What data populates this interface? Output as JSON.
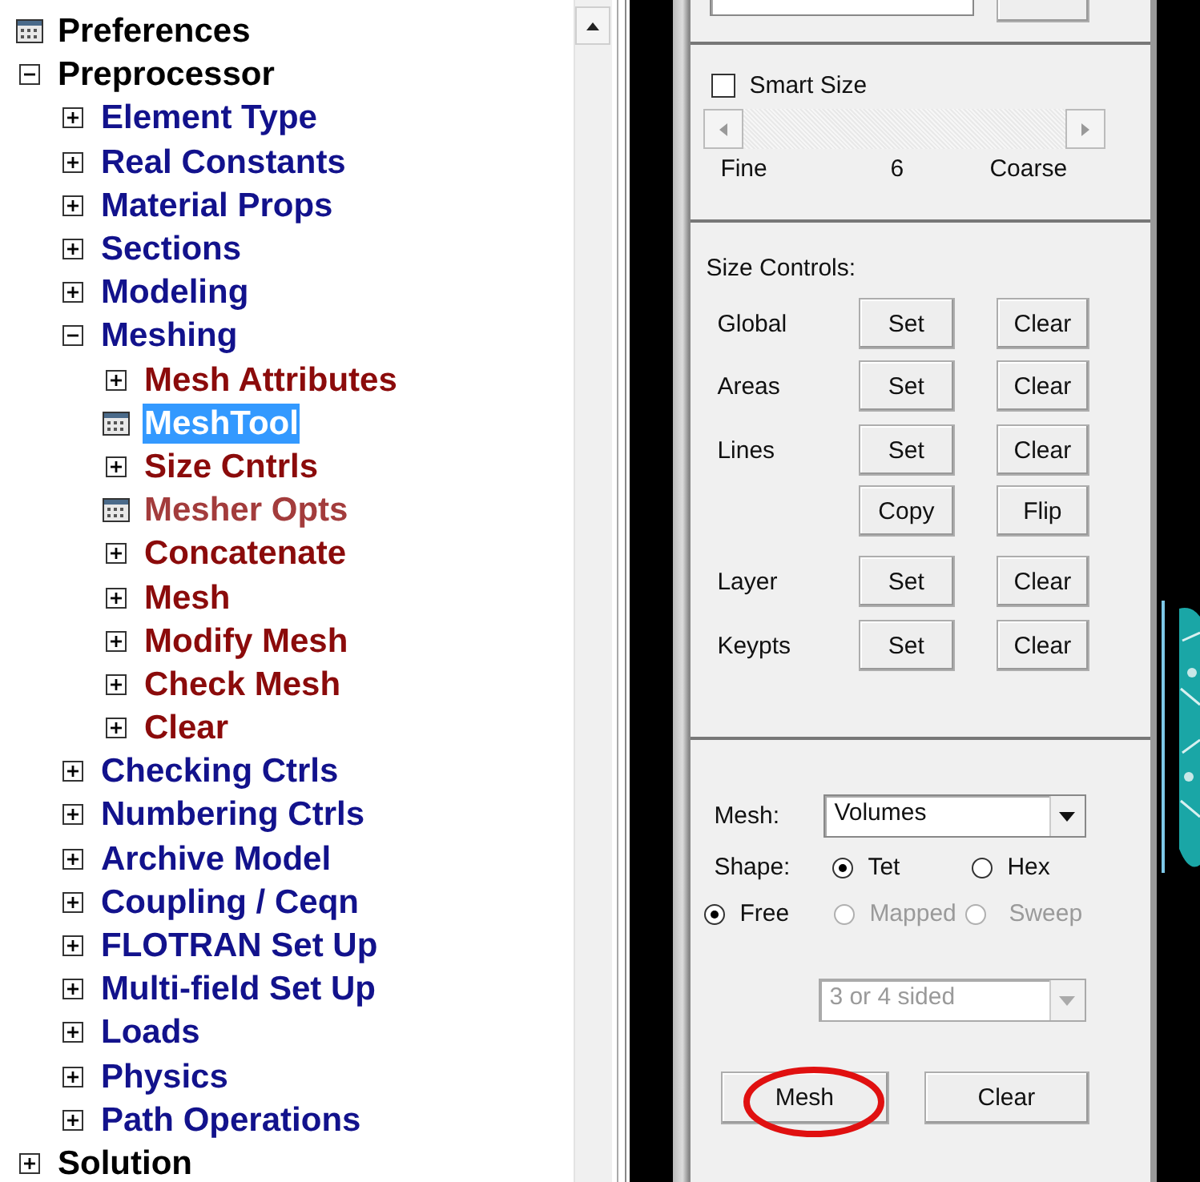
{
  "tree": [
    {
      "label": "Preferences",
      "kind": "dialog",
      "selected": false
    },
    {
      "label": "Preprocessor",
      "kind": "folder",
      "expanded": true,
      "selected": false,
      "children": [
        {
          "label": "Element Type",
          "kind": "folder",
          "expanded": false,
          "selected": false
        },
        {
          "label": "Real Constants",
          "kind": "folder",
          "expanded": false,
          "selected": false
        },
        {
          "label": "Material Props",
          "kind": "folder",
          "expanded": false,
          "selected": false
        },
        {
          "label": "Sections",
          "kind": "folder",
          "expanded": false,
          "selected": false
        },
        {
          "label": "Modeling",
          "kind": "folder",
          "expanded": false,
          "selected": false
        },
        {
          "label": "Meshing",
          "kind": "folder",
          "expanded": true,
          "selected": false,
          "children": [
            {
              "label": "Mesh Attributes",
              "kind": "folder",
              "expanded": false,
              "selected": false
            },
            {
              "label": "MeshTool",
              "kind": "dialog",
              "selected": true
            },
            {
              "label": "Size Cntrls",
              "kind": "folder",
              "expanded": false,
              "selected": false
            },
            {
              "label": "Mesher Opts",
              "kind": "dialog",
              "selected": false
            },
            {
              "label": "Concatenate",
              "kind": "folder",
              "expanded": false,
              "selected": false
            },
            {
              "label": "Mesh",
              "kind": "folder",
              "expanded": false,
              "selected": false
            },
            {
              "label": "Modify Mesh",
              "kind": "folder",
              "expanded": false,
              "selected": false
            },
            {
              "label": "Check Mesh",
              "kind": "folder",
              "expanded": false,
              "selected": false
            },
            {
              "label": "Clear",
              "kind": "folder",
              "expanded": false,
              "selected": false
            }
          ]
        },
        {
          "label": "Checking Ctrls",
          "kind": "folder",
          "expanded": false,
          "selected": false
        },
        {
          "label": "Numbering Ctrls",
          "kind": "folder",
          "expanded": false,
          "selected": false
        },
        {
          "label": "Archive Model",
          "kind": "folder",
          "expanded": false,
          "selected": false
        },
        {
          "label": "Coupling / Ceqn",
          "kind": "folder",
          "expanded": false,
          "selected": false
        },
        {
          "label": "FLOTRAN Set Up",
          "kind": "folder",
          "expanded": false,
          "selected": false
        },
        {
          "label": "Multi-field Set Up",
          "kind": "folder",
          "expanded": false,
          "selected": false
        },
        {
          "label": "Loads",
          "kind": "folder",
          "expanded": false,
          "selected": false
        },
        {
          "label": "Physics",
          "kind": "folder",
          "expanded": false,
          "selected": false
        },
        {
          "label": "Path Operations",
          "kind": "folder",
          "expanded": false,
          "selected": false
        }
      ]
    },
    {
      "label": "Solution",
      "kind": "folder",
      "expanded": false,
      "selected": false
    }
  ],
  "meshtool": {
    "smart_size": {
      "label": "Smart Size",
      "checked": false
    },
    "size_scale": {
      "min_label": "Fine",
      "reading": "6",
      "max_label": "Coarse"
    },
    "size_controls": {
      "title": "Size Controls:",
      "rows": [
        {
          "label": "Global",
          "buttons": [
            "Set",
            "Clear"
          ]
        },
        {
          "label": "Areas",
          "buttons": [
            "Set",
            "Clear"
          ]
        },
        {
          "label": "Lines",
          "buttons": [
            "Set",
            "Clear"
          ]
        },
        {
          "buttons": [
            "Copy",
            "Flip"
          ]
        },
        {
          "label": "Layer",
          "buttons": [
            "Set",
            "Clear"
          ]
        },
        {
          "label": "Keypts",
          "buttons": [
            "Set",
            "Clear"
          ]
        }
      ]
    },
    "mesh": {
      "label": "Mesh:",
      "value": "Volumes"
    },
    "shape": {
      "label": "Shape:",
      "options": [
        {
          "label": "Tet",
          "selected": true
        },
        {
          "label": "Hex",
          "selected": false
        }
      ]
    },
    "method": [
      {
        "label": "Free",
        "selected": true,
        "disabled": false
      },
      {
        "label": "Mapped",
        "selected": false,
        "disabled": true
      },
      {
        "label": "Sweep",
        "selected": false,
        "disabled": true
      }
    ],
    "sides": {
      "value": "3 or 4 sided",
      "disabled": true
    },
    "actions": [
      {
        "label": "Mesh",
        "circled": true
      },
      {
        "label": "Clear",
        "circled": false
      }
    ]
  }
}
